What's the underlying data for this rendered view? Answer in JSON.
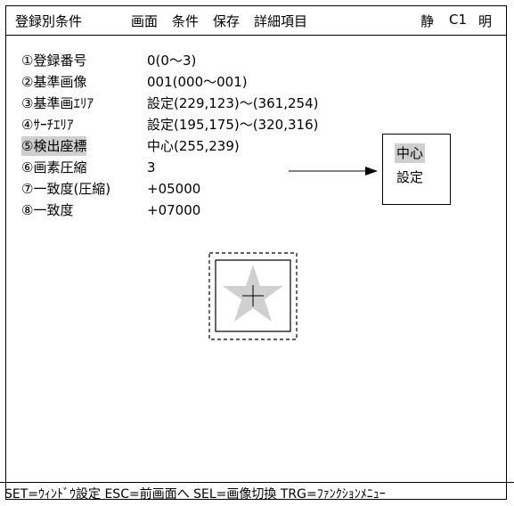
{
  "menubar": {
    "title": "登録別条件",
    "items": [
      "画面",
      "条件",
      "保存",
      "詳細項目"
    ],
    "mode": "静",
    "camera": "C1",
    "light": "明"
  },
  "settings": [
    {
      "label": "①登録番号",
      "value": "0(0～3)"
    },
    {
      "label": "②基準画像",
      "value": "001(000～001)"
    },
    {
      "label": "③基準画ｴﾘｱ",
      "value": "設定(229,123)～(361,254)"
    },
    {
      "label": "④ｻｰﾁｴﾘｱ",
      "value": "設定(195,175)～(320,316)"
    },
    {
      "label": "⑤検出座標",
      "value": "中心(255,239)"
    },
    {
      "label": "⑥画素圧縮",
      "value": "3"
    },
    {
      "label": "⑦一致度(圧縮)",
      "value": "+05000"
    },
    {
      "label": "⑧一致度",
      "value": "+07000"
    }
  ],
  "popup": {
    "options": [
      "中心",
      "設定"
    ],
    "selected": "中心"
  },
  "statusbar": {
    "text": "SET=ｳｨﾝﾄﾞｳ設定  ESC=前画面へ  SEL=画像切換  TRG=ﾌｧﾝｸｼｮﾝﾒﾆｭｰ"
  },
  "colors": {
    "highlight": "#cfcfcf",
    "star_fill": "#d0d0d0",
    "line": "#000000"
  },
  "icons": {
    "arrow": "arrow-right-icon",
    "preview": "star-template-icon",
    "crosshair": "crosshair-icon"
  }
}
